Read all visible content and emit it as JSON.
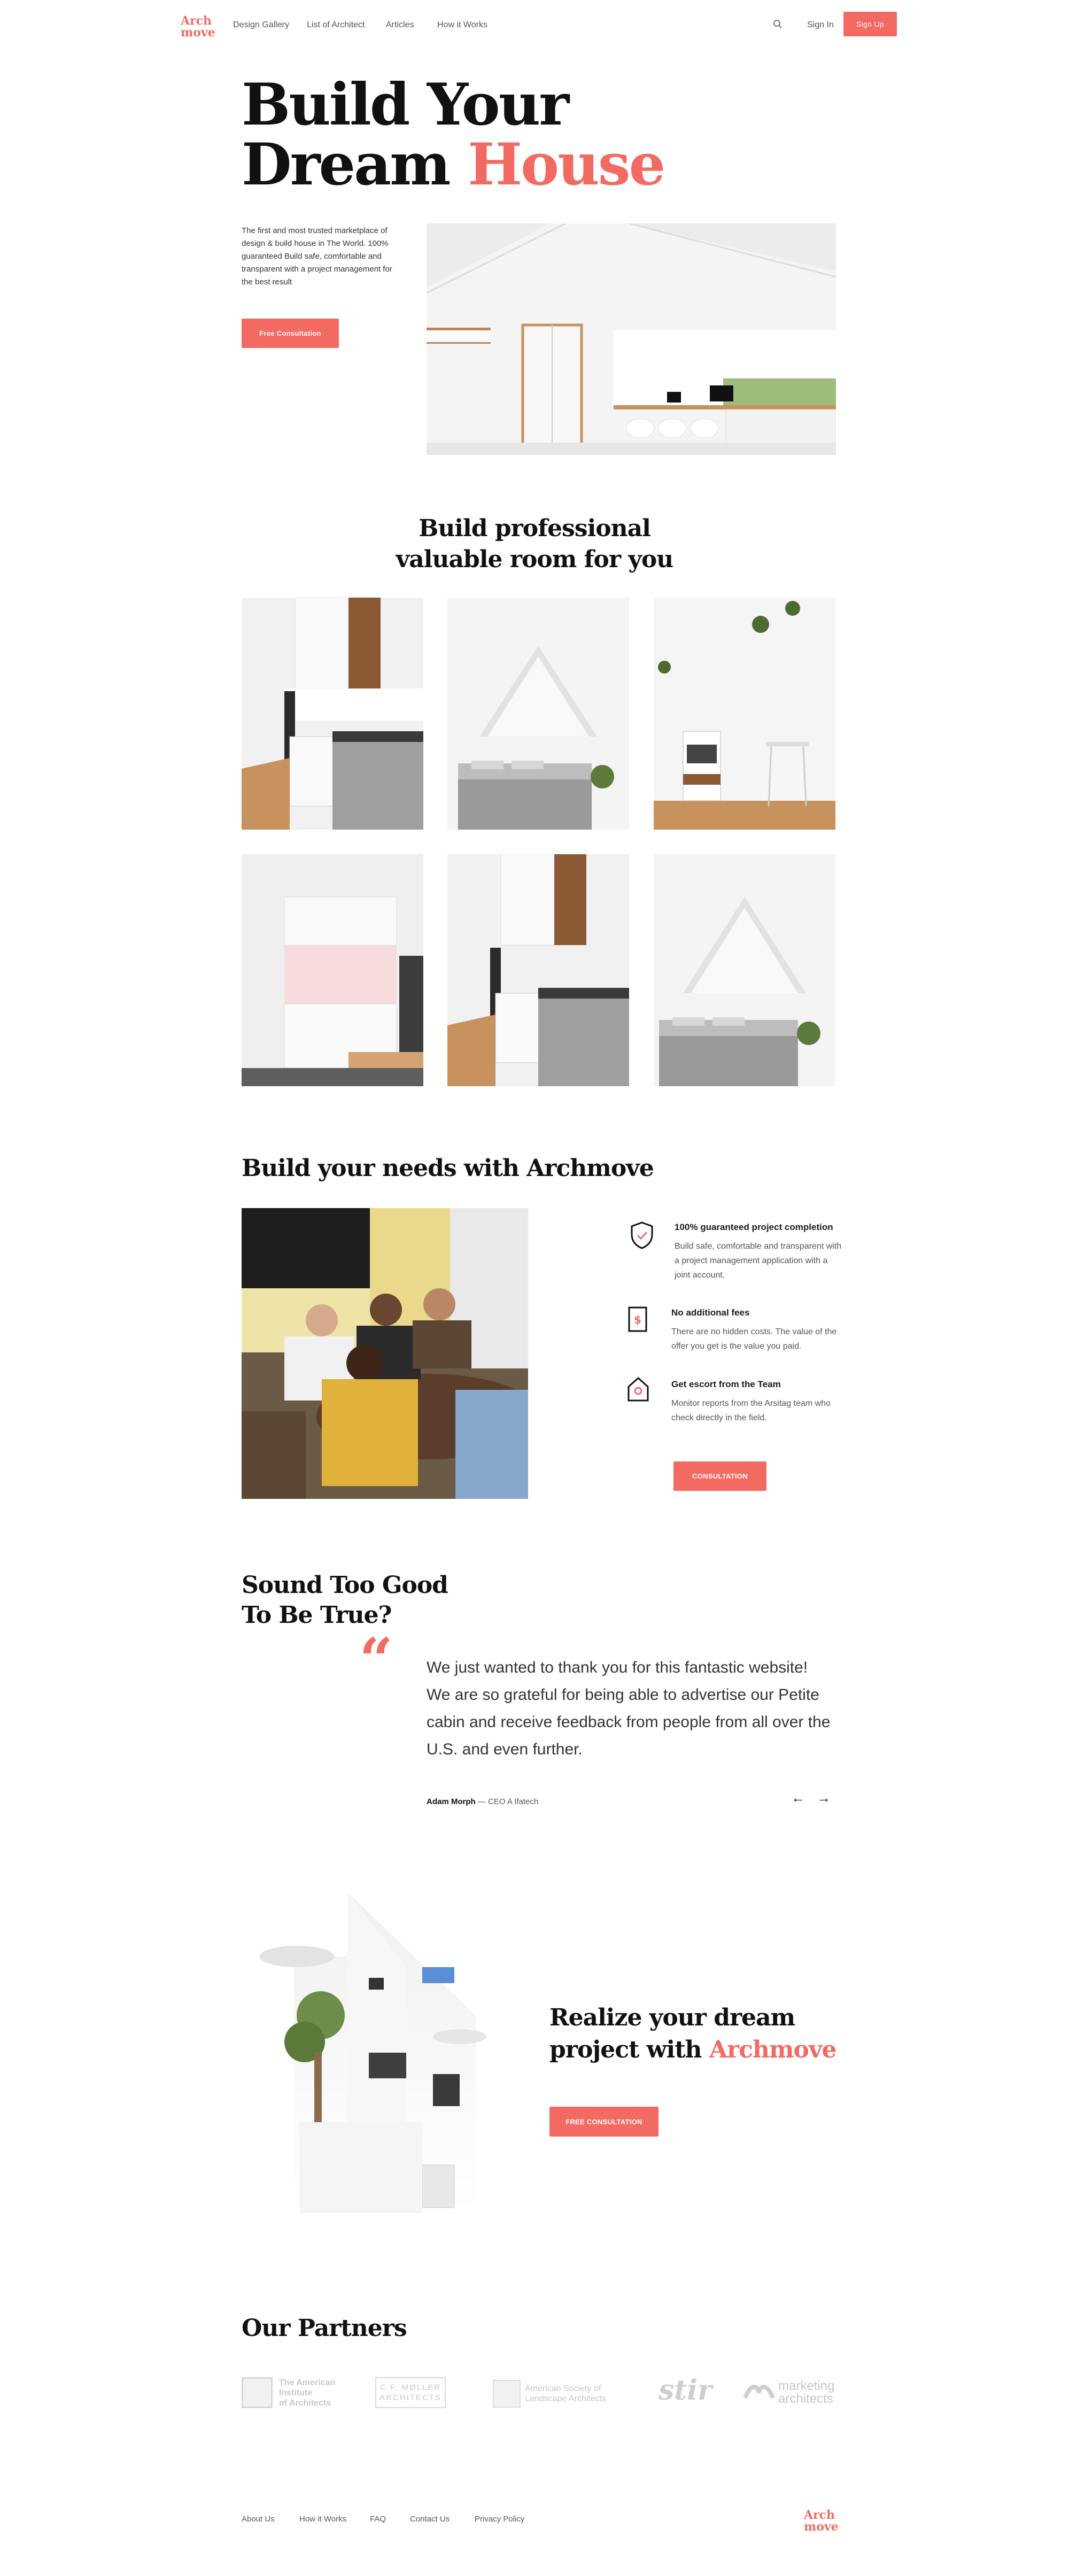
{
  "nav": {
    "logo_line1": "Arch",
    "logo_line2": "move",
    "links": [
      "Design Gallery",
      "List of Architect",
      "Articles",
      "How it Works"
    ],
    "sign_in": "Sign In",
    "sign_up": "Sign Up"
  },
  "hero": {
    "title_line1": "Build Your",
    "title_line2_plain": "Dream ",
    "title_line2_accent": "House",
    "description": "The first and most trusted marketplace of design & build house in The World. 100% guaranteed Build safe, comfortable and transparent with a project management for the best result",
    "cta": "Free Consultation"
  },
  "rooms": {
    "title_line1": "Build professional",
    "title_line2": "valuable room for you"
  },
  "needs": {
    "title": "Build your needs with Archmove",
    "features": [
      {
        "icon": "shield-check-icon",
        "title": "100% guaranteed project completion",
        "desc": "Build safe, comfortable and transparent with a project management application with a joint account."
      },
      {
        "icon": "dollar-document-icon",
        "title": "No additional fees",
        "desc": "There are no hidden costs. The value of the offer you get is the value you paid."
      },
      {
        "icon": "house-pin-icon",
        "title": "Get escort from the Team",
        "desc": "Monitor reports from the Arsitag team who check directly in the field."
      }
    ],
    "cta": "CONSULTATION"
  },
  "testimonial": {
    "title_line1": "Sound Too Good",
    "title_line2": "To Be True?",
    "quote_mark": "“",
    "quote": "We just wanted to thank you for this fantastic website! We are so grateful for being able to advertise our Petite cabin and receive feedback from people from all over the U.S. and even further.",
    "author": "Adam Morph",
    "role": " — CEO A Ifatech",
    "prev": "←",
    "next": "→"
  },
  "dream": {
    "title_line1": "Realize your dream",
    "title_line2_plain": "project with ",
    "title_line2_accent": "Archmove",
    "cta": "FREE CONSULTATION"
  },
  "partners": {
    "title": "Our Partners",
    "items": [
      {
        "line1": "The American",
        "line2": "Institute",
        "line3": "of Architects"
      },
      {
        "line1": "C.F. MØLLER",
        "line2": "ARCHITECTS"
      },
      {
        "line1": "American Society of",
        "line2": "Landscape Architects"
      },
      {
        "line1": "stir"
      },
      {
        "line1": "marketing",
        "line2": "architects"
      }
    ]
  },
  "footer": {
    "links": [
      "About Us",
      "How it Works",
      "FAQ",
      "Contact Us",
      "Privacy Policy"
    ],
    "logo_line1": "Arch",
    "logo_line2": "move"
  },
  "colors": {
    "accent": "#f26a62",
    "text": "#1b1b1b",
    "muted": "#555555"
  }
}
